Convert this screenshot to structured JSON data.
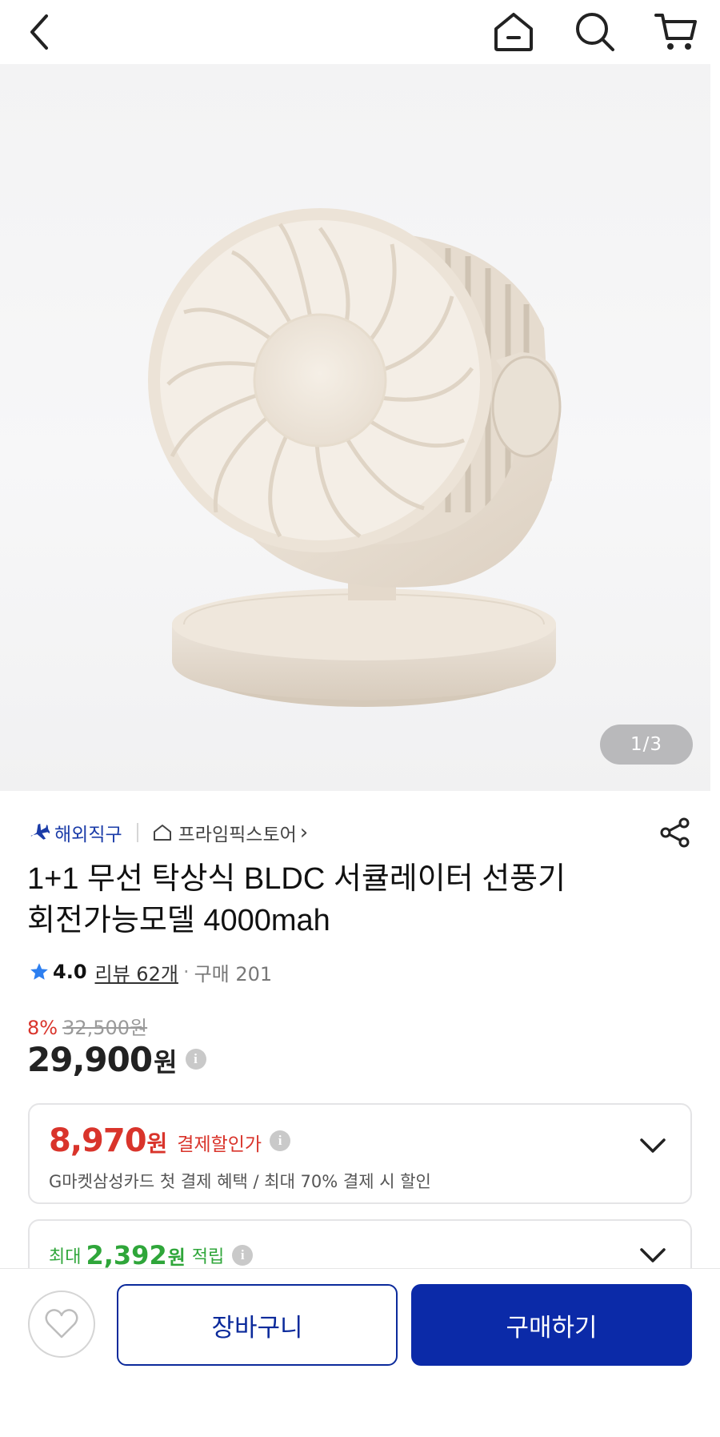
{
  "header": {
    "back_icon": "chevron-left-icon",
    "home_icon": "home-icon",
    "search_icon": "search-icon",
    "cart_icon": "cart-icon"
  },
  "gallery": {
    "page_indicator": "1/3",
    "image_subject": "desk-fan-image"
  },
  "seller": {
    "badge_label": "해외직구",
    "store_name": "프라임픽스토어",
    "store_chevron": "›",
    "share_icon": "share-icon"
  },
  "product": {
    "title_line1": "1+1 무선 탁상식 BLDC 서큘레이터 선풍기",
    "title_line2": "회전가능모델 4000mah",
    "rating": "4.0",
    "reviews": "리뷰 62개",
    "separator": "·",
    "purchases": "구매 201"
  },
  "price": {
    "discount_rate": "8%",
    "original_price": "32,500원",
    "price": "29,900",
    "currency": "원",
    "info": "i"
  },
  "benefits": {
    "card_discount": {
      "amount": "8,970",
      "currency": "원",
      "label": "결제할인가",
      "info": "i",
      "description": "G마켓삼성카드 첫 결제 혜택 / 최대 70% 결제 시 할인"
    },
    "points": {
      "prefix": "최대",
      "amount": "2,392",
      "currency": "원",
      "label": "적립",
      "info": "i"
    }
  },
  "bottom_bar": {
    "wishlist_icon": "heart-icon",
    "cart_label": "장바구니",
    "buy_label": "구매하기"
  },
  "colors": {
    "primary_blue": "#0b2aa8",
    "discount_red": "#d9342b",
    "points_green": "#2fa63a",
    "badge_blue": "#1b3ca8"
  }
}
